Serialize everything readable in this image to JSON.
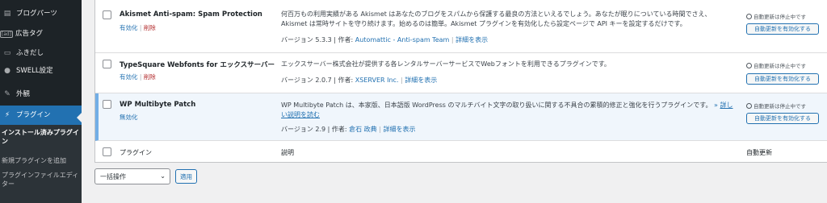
{
  "sidebar": {
    "items": [
      {
        "label": "ブログパーツ",
        "icon": "blog-parts-icon"
      },
      {
        "label": "広告タグ",
        "icon": "ad-icon",
        "icon_text": "[ad]"
      },
      {
        "label": "ふきだし",
        "icon": "speech-bubble-icon"
      },
      {
        "label": "SWELL設定",
        "icon": "swell-icon"
      },
      {
        "label": "外観",
        "icon": "appearance-icon"
      },
      {
        "label": "プラグイン",
        "icon": "plugin-icon"
      }
    ],
    "submenu": [
      {
        "label": "インストール済みプラグイン"
      },
      {
        "label": "新規プラグインを追加"
      },
      {
        "label": "プラグインファイルエディター"
      }
    ]
  },
  "plugins": [
    {
      "name": "Akismet Anti-spam: Spam Protection",
      "action_primary": "有効化",
      "action_delete": "削除",
      "description": "何百万もの利用実績がある Akismet はあなたのブログをスパムから保護する最良の方法といえるでしょう。あなたが眠りについている時間でさえ、Akismet は常時サイトを守り続けます。始めるのは簡単。Akismet プラグインを有効化したら設定ページで API キーを設定するだけです。",
      "version_label": "バージョン 5.3.3 | 作者: ",
      "author": "Automattic - Anti-spam Team",
      "details": "詳細を表示",
      "autoupdate_status": "自動更新は停止中です",
      "autoupdate_button": "自動更新を有効化する"
    },
    {
      "name": "TypeSquare Webfonts for エックスサーバー",
      "action_primary": "有効化",
      "action_delete": "削除",
      "description": "エックスサーバー株式会社が提供する各レンタルサーバーサービスでWebフォントを利用できるプラグインです。",
      "version_label": "バージョン 2.0.7 | 作者: ",
      "author": "XSERVER Inc.",
      "details": "詳細を表示",
      "autoupdate_status": "自動更新は停止中です",
      "autoupdate_button": "自動更新を有効化する"
    },
    {
      "name": "WP Multibyte Patch",
      "action_primary": "無効化",
      "description": "WP Multibyte Patch は、本家版、日本語版 WordPress のマルチバイト文字の取り扱いに関する不具合の累積的修正と強化を行うプラグインです。",
      "more_mark": "»",
      "read_more": "詳しい説明を読む",
      "version_label": "バージョン 2.9 | 作者: ",
      "author": "倉石 政典",
      "details": "詳細を表示",
      "autoupdate_status": "自動更新は停止中です",
      "autoupdate_button": "自動更新を有効化する"
    }
  ],
  "footer": {
    "col_plugin": "プラグイン",
    "col_description": "説明",
    "col_autoupdate": "自動更新"
  },
  "bulk": {
    "selected": "一括操作",
    "apply": "適用"
  },
  "colors": {
    "sidebar_bg": "#1d2327",
    "active_menu": "#2271b1",
    "link": "#2271b1",
    "delete": "#b32d2e",
    "active_row_bg": "#f0f6fc"
  }
}
